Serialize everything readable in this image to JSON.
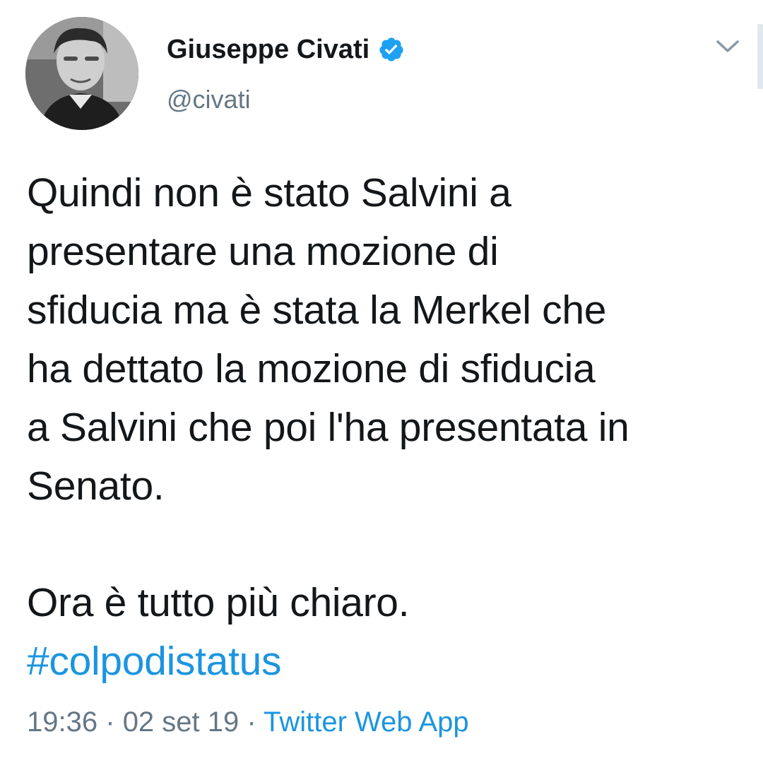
{
  "author": {
    "display_name": "Giuseppe Civati",
    "handle": "@civati",
    "verified": true,
    "verified_color": "#1da1f2"
  },
  "tweet": {
    "text": "Quindi non è stato Salvini a\npresentare una mozione di\nsfiducia ma è stata la Merkel che\nha dettato la mozione di sfiducia\na Salvini che poi l'ha presentata in\nSenato.",
    "text_2": "Ora è tutto più chiaro.",
    "hashtag": "#colpodistatus",
    "hashtag_color": "#1b95e0"
  },
  "meta": {
    "time": "19:36",
    "separator": "·",
    "date": "02 set 19",
    "source": "Twitter Web App"
  },
  "icons": {
    "menu": "chevron-down-icon",
    "verified": "verified-badge-icon"
  }
}
